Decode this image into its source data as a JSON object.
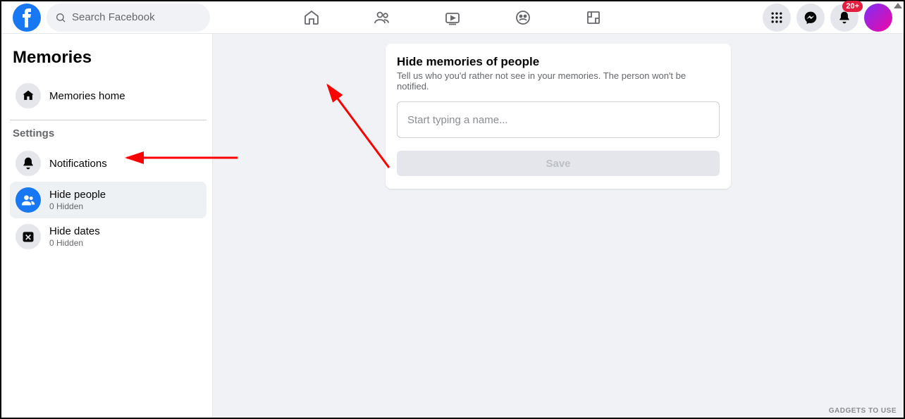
{
  "search": {
    "placeholder": "Search Facebook"
  },
  "notifications": {
    "badge": "20+"
  },
  "sidebar": {
    "title": "Memories",
    "home": "Memories home",
    "settings_label": "Settings",
    "items": [
      {
        "label": "Notifications"
      },
      {
        "label": "Hide people",
        "sub": "0 Hidden"
      },
      {
        "label": "Hide dates",
        "sub": "0 Hidden"
      }
    ]
  },
  "card": {
    "title": "Hide memories of people",
    "description": "Tell us who you'd rather not see in your memories. The person won't be notified.",
    "input_placeholder": "Start typing a name...",
    "save_label": "Save"
  },
  "watermark": "GADGETS TO USE"
}
